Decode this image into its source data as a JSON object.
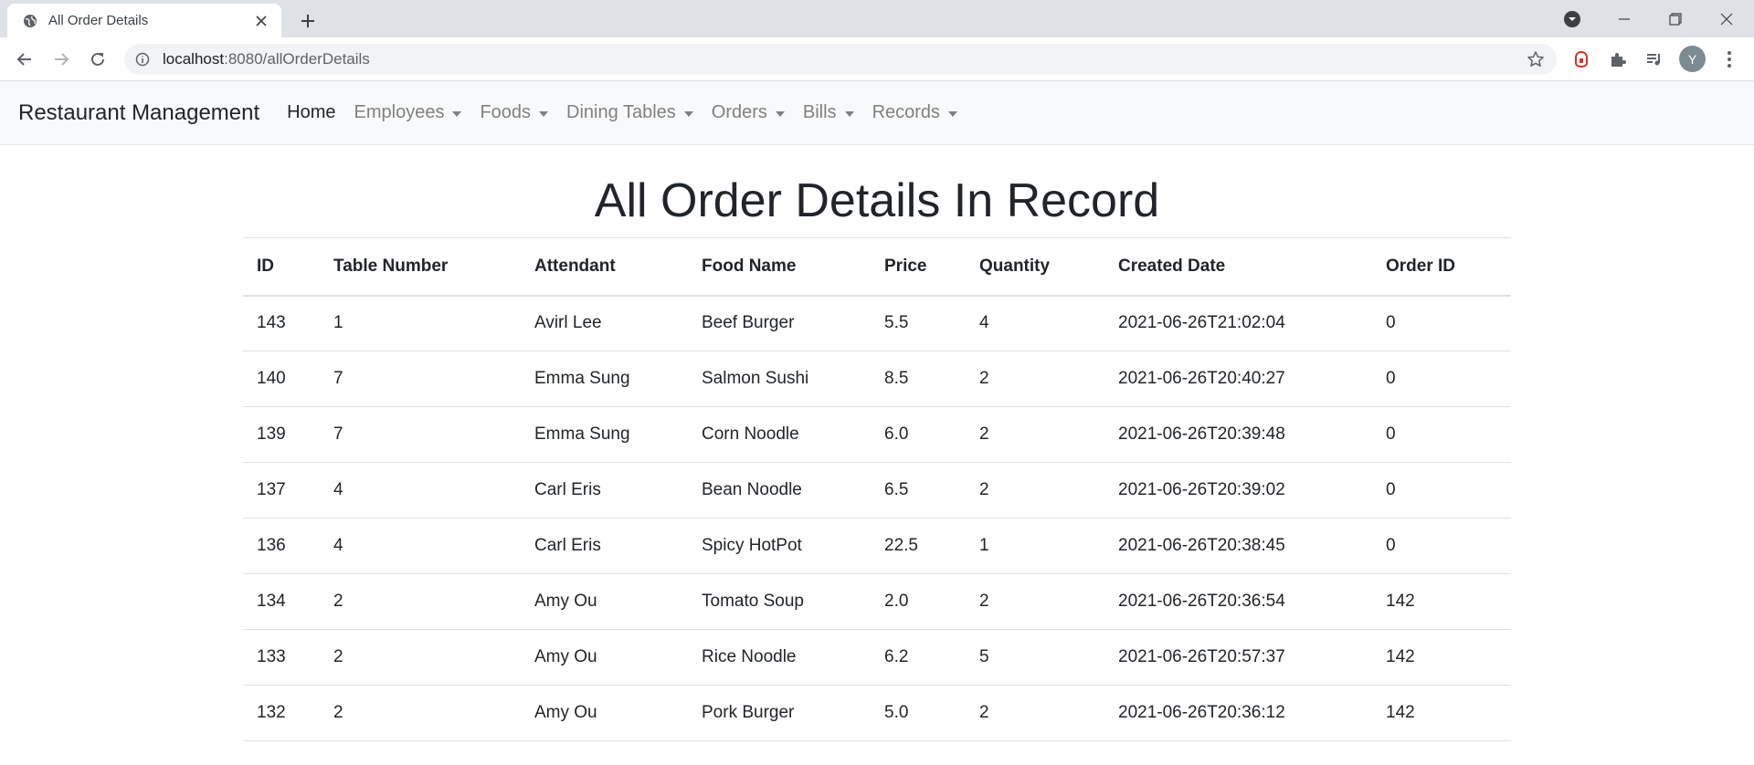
{
  "browser": {
    "tab_title": "All Order Details",
    "url_host": "localhost",
    "url_path": ":8080/allOrderDetails",
    "profile_initial": "Y"
  },
  "navbar": {
    "brand": "Restaurant Management",
    "home": "Home",
    "menus": [
      "Employees",
      "Foods",
      "Dining Tables",
      "Orders",
      "Bills",
      "Records"
    ]
  },
  "page": {
    "title": "All Order Details In Record"
  },
  "table": {
    "headers": [
      "ID",
      "Table Number",
      "Attendant",
      "Food Name",
      "Price",
      "Quantity",
      "Created Date",
      "Order ID"
    ],
    "rows": [
      [
        "143",
        "1",
        "Avirl Lee",
        "Beef Burger",
        "5.5",
        "4",
        "2021-06-26T21:02:04",
        "0"
      ],
      [
        "140",
        "7",
        "Emma Sung",
        "Salmon Sushi",
        "8.5",
        "2",
        "2021-06-26T20:40:27",
        "0"
      ],
      [
        "139",
        "7",
        "Emma Sung",
        "Corn Noodle",
        "6.0",
        "2",
        "2021-06-26T20:39:48",
        "0"
      ],
      [
        "137",
        "4",
        "Carl Eris",
        "Bean Noodle",
        "6.5",
        "2",
        "2021-06-26T20:39:02",
        "0"
      ],
      [
        "136",
        "4",
        "Carl Eris",
        "Spicy HotPot",
        "22.5",
        "1",
        "2021-06-26T20:38:45",
        "0"
      ],
      [
        "134",
        "2",
        "Amy Ou",
        "Tomato Soup",
        "2.0",
        "2",
        "2021-06-26T20:36:54",
        "142"
      ],
      [
        "133",
        "2",
        "Amy Ou",
        "Rice Noodle",
        "6.2",
        "5",
        "2021-06-26T20:57:37",
        "142"
      ],
      [
        "132",
        "2",
        "Amy Ou",
        "Pork Burger",
        "5.0",
        "2",
        "2021-06-26T20:36:12",
        "142"
      ]
    ]
  },
  "colors": {
    "navbar_bg": "#f8f9fa",
    "nav_link_muted": "#808080",
    "text": "#212529",
    "table_border": "#dee2e6",
    "extension_red": "#d93025"
  }
}
